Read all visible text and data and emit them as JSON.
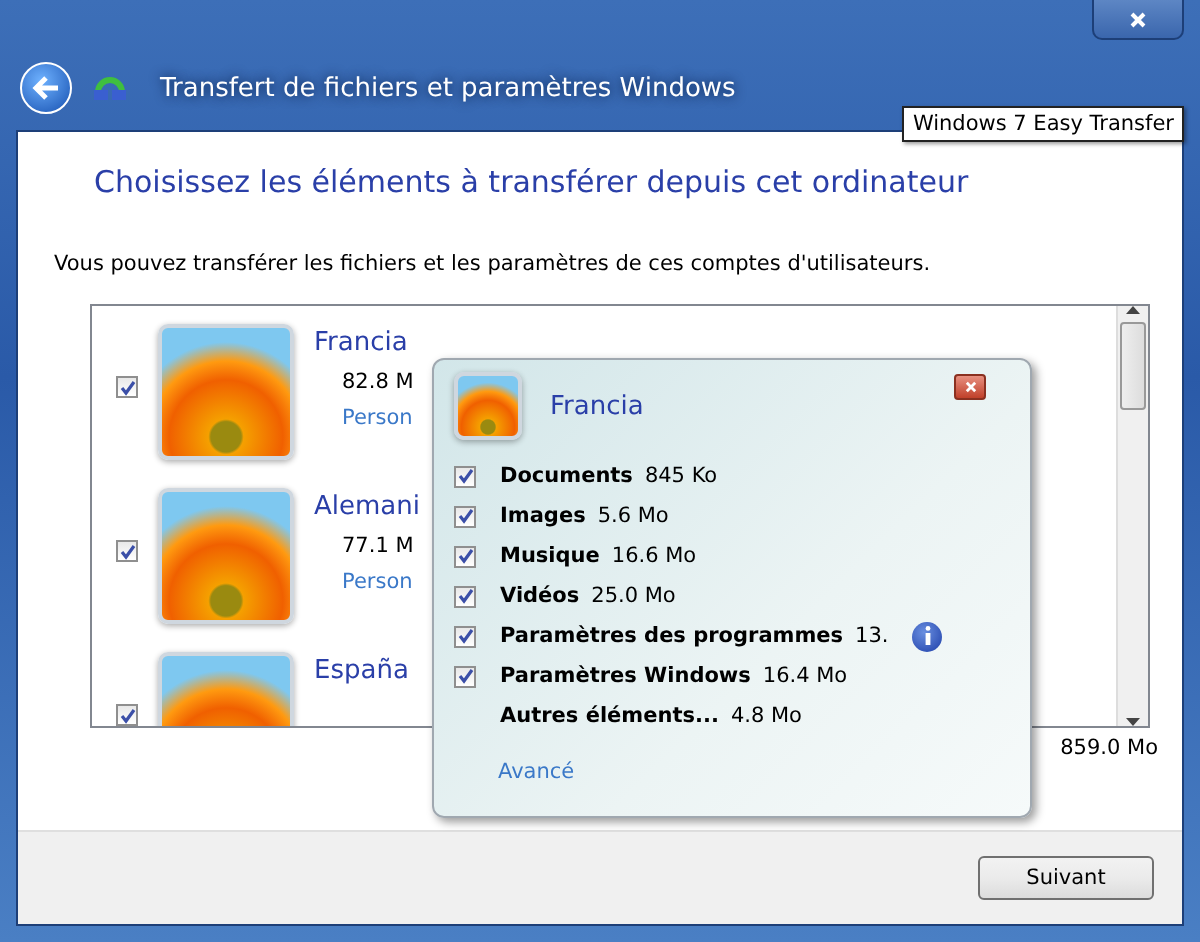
{
  "window": {
    "title": "Transfert de fichiers et paramètres Windows",
    "tooltip": "Windows 7 Easy Transfer"
  },
  "heading": "Choisissez les éléments à transférer depuis cet ordinateur",
  "intro": "Vous pouvez transférer les fichiers et les paramètres de ces comptes d'utilisateurs.",
  "accounts": [
    {
      "name": "Francia",
      "size": "82.8 M",
      "link": "Person",
      "checked": true
    },
    {
      "name": "Alemani",
      "size": "77.1 M",
      "link": "Person",
      "checked": true
    },
    {
      "name": "España",
      "checked": true
    }
  ],
  "total": "859.0 Mo",
  "popup": {
    "name": "Francia",
    "items": [
      {
        "kind": "checkbox",
        "label": "Documents",
        "size": "845 Ko",
        "checked": true,
        "info": false
      },
      {
        "kind": "checkbox",
        "label": "Images",
        "size": "5.6 Mo",
        "checked": true,
        "info": false
      },
      {
        "kind": "checkbox",
        "label": "Musique",
        "size": "16.6 Mo",
        "checked": true,
        "info": false
      },
      {
        "kind": "checkbox",
        "label": "Vidéos",
        "size": "25.0 Mo",
        "checked": true,
        "info": false
      },
      {
        "kind": "checkbox",
        "label": "Paramètres des programmes",
        "size": "13.",
        "checked": true,
        "info": true
      },
      {
        "kind": "checkbox",
        "label": "Paramètres Windows",
        "size": "16.4 Mo",
        "checked": true,
        "info": false
      },
      {
        "kind": "text",
        "label": "Autres éléments...",
        "size": "4.8 Mo"
      }
    ],
    "link": "Avancé"
  },
  "next_button": "Suivant"
}
